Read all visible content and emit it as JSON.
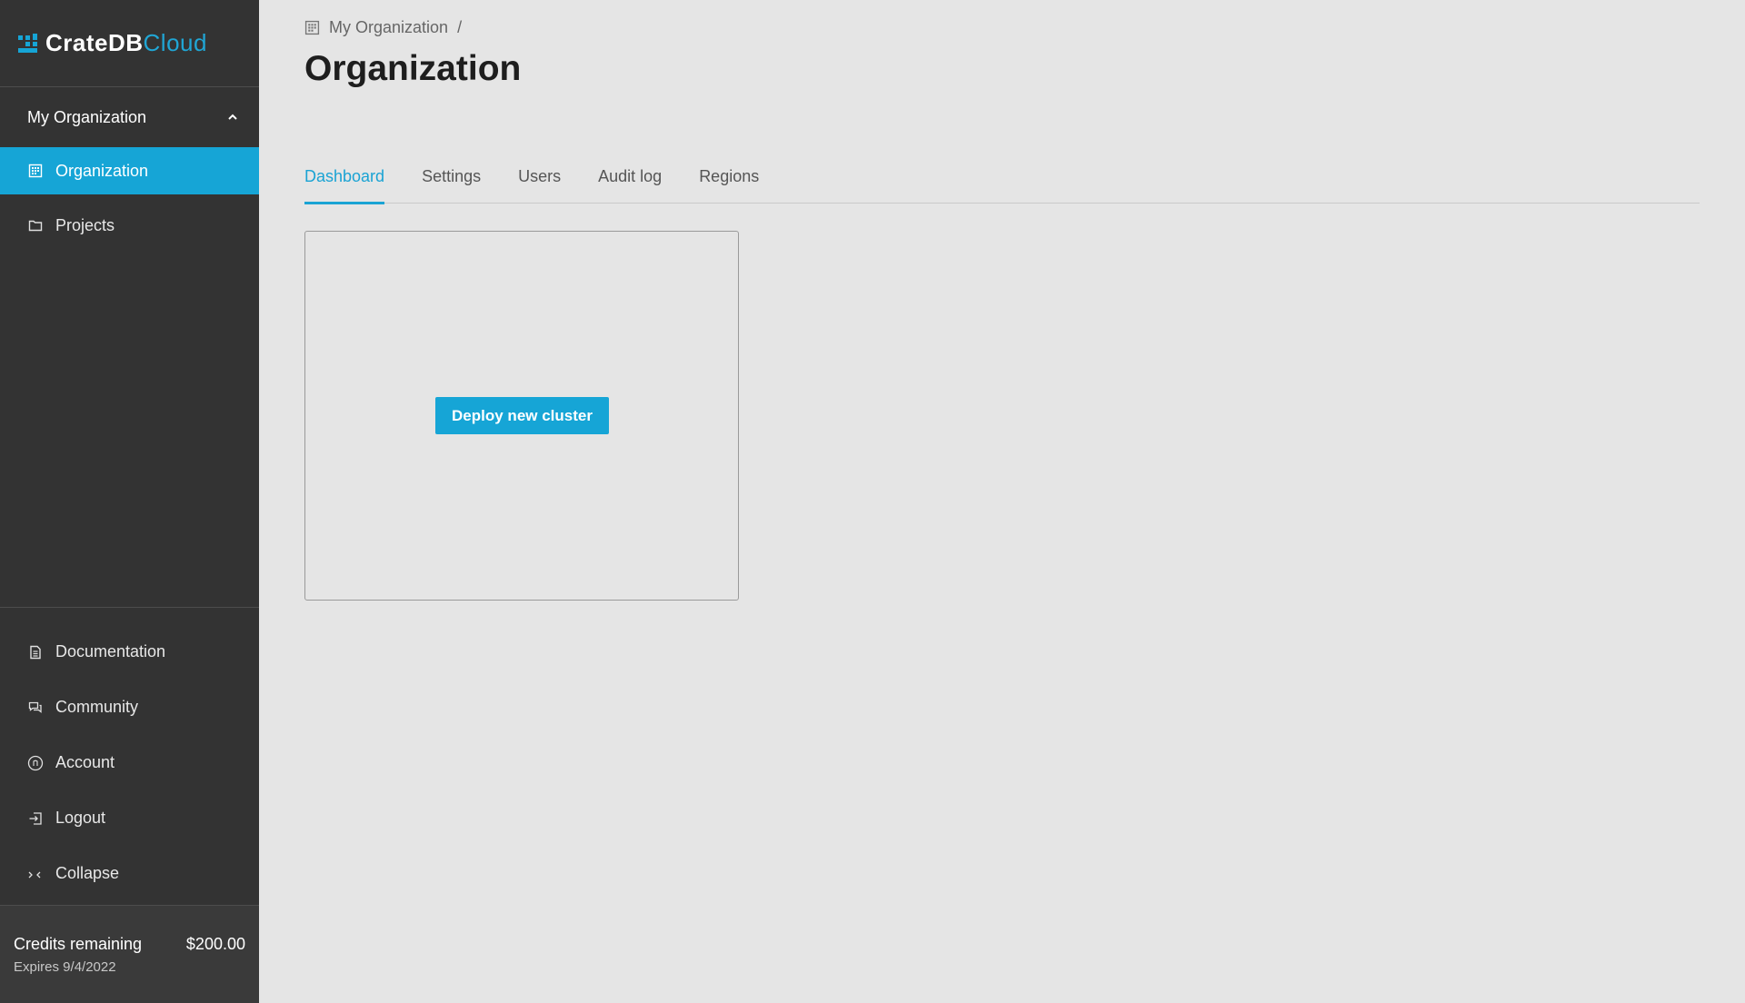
{
  "brand": {
    "name_part1": "CrateDB",
    "name_part2": "Cloud",
    "accent": "#16a5d6"
  },
  "sidebar": {
    "org_selector": {
      "label": "My Organization",
      "icon": "chevron-up-icon"
    },
    "items": [
      {
        "label": "Organization",
        "icon": "building-icon",
        "active": true
      },
      {
        "label": "Projects",
        "icon": "folder-icon",
        "active": false
      }
    ],
    "bottom_items": [
      {
        "label": "Documentation",
        "icon": "document-icon"
      },
      {
        "label": "Community",
        "icon": "chat-icon"
      },
      {
        "label": "Account",
        "icon": "account-icon"
      },
      {
        "label": "Logout",
        "icon": "logout-icon"
      },
      {
        "label": "Collapse",
        "icon": "collapse-icon"
      }
    ],
    "credits": {
      "label": "Credits remaining",
      "amount": "$200.00",
      "expires": "Expires 9/4/2022"
    }
  },
  "main": {
    "breadcrumb": {
      "item": "My Organization",
      "separator": "/"
    },
    "title": "Organization",
    "tabs": [
      {
        "label": "Dashboard",
        "active": true
      },
      {
        "label": "Settings",
        "active": false
      },
      {
        "label": "Users",
        "active": false
      },
      {
        "label": "Audit log",
        "active": false
      },
      {
        "label": "Regions",
        "active": false
      }
    ],
    "card": {
      "button_label": "Deploy new cluster"
    }
  }
}
